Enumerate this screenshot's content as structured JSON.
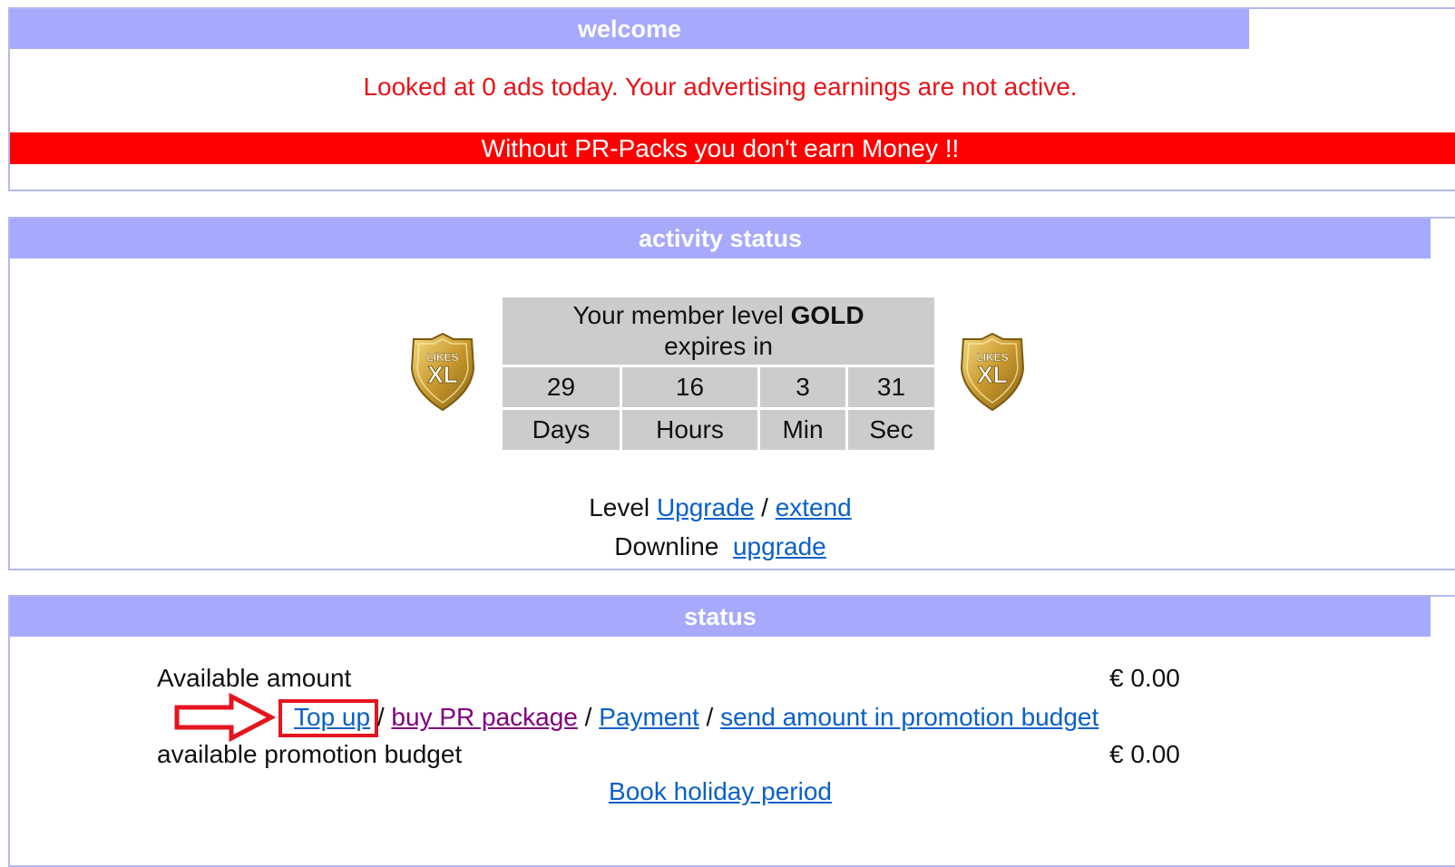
{
  "welcome": {
    "title": "welcome",
    "notice": "Looked at 0 ads today. Your advertising earnings are not active.",
    "warning_bar": "Without PR-Packs you don't earn Money !!"
  },
  "activity": {
    "title": "activity status",
    "badge_text_top": "LIKES",
    "badge_text_main": "XL",
    "member_level_prefix": "Your member level",
    "member_level": "GOLD",
    "expires_label": "expires in",
    "countdown": [
      {
        "value": "29",
        "unit": "Days"
      },
      {
        "value": "16",
        "unit": "Hours"
      },
      {
        "value": "3",
        "unit": "Min"
      },
      {
        "value": "31",
        "unit": "Sec"
      }
    ],
    "level_label": "Level",
    "upgrade_link": "Upgrade",
    "separator": "/",
    "extend_link": "extend",
    "downline_label": "Downline",
    "downline_upgrade_link": "upgrade"
  },
  "status": {
    "title": "status",
    "available_amount_label": "Available amount",
    "available_amount_value": "€ 0.00",
    "links": {
      "top_up": "Top up",
      "buy_pr": "buy PR package",
      "payment": "Payment",
      "send_amount": "send amount in promotion budget",
      "sep": "/"
    },
    "promo_budget_label": "available promotion budget",
    "promo_budget_value": "€ 0.00",
    "holiday_link": "Book holiday period"
  },
  "colors": {
    "header_bg": "#a7a9fc",
    "warning_red": "#ff0000",
    "notice_red": "#e8141a",
    "link_blue": "#0a60c8",
    "visited_purple": "#800080",
    "highlight_red": "#e6141e"
  }
}
